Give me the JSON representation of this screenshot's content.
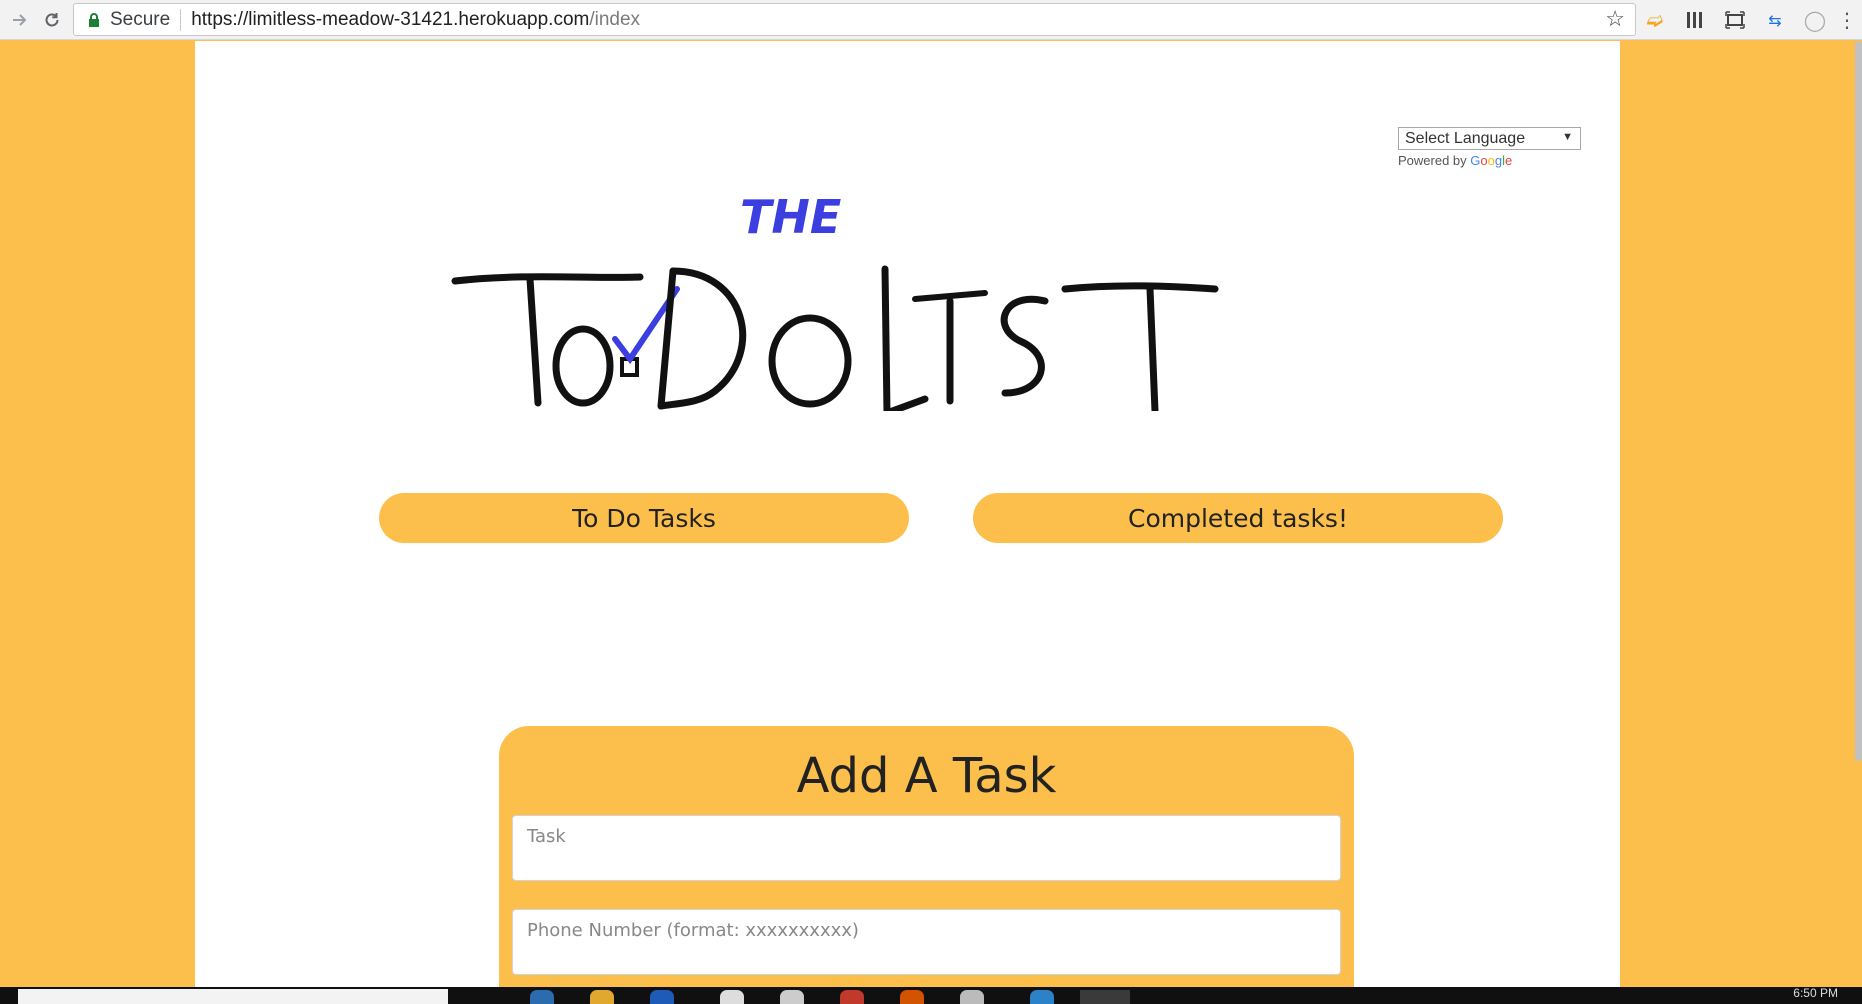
{
  "browser": {
    "secure_label": "Secure",
    "url_base": "https://limitless-meadow-31421.herokuapp.com",
    "url_path": "/index",
    "icons": [
      "forward-icon",
      "reload-icon",
      "lock-icon",
      "bookmark-star-icon",
      "extension-arrow-icon",
      "extension-bars-icon",
      "extension-screen-icon",
      "extension-swap-icon",
      "extension-circle-icon",
      "menu-kebab-icon"
    ]
  },
  "translate": {
    "select_label": "Select Language",
    "powered_by": "Powered by",
    "google": [
      "G",
      "o",
      "o",
      "g",
      "l",
      "e"
    ]
  },
  "logo": {
    "the": "THE",
    "todo_list": "ToDoList",
    "colors": {
      "ink": "#111111",
      "accent": "#3b3fe0"
    }
  },
  "nav": {
    "todo_tasks": "To Do Tasks",
    "completed_tasks": "Completed tasks!"
  },
  "form": {
    "title": "Add A Task",
    "task_placeholder": "Task",
    "phone_placeholder": "Phone Number (format: xxxxxxxxxx)"
  },
  "taskbar": {
    "clock": "6:50 PM"
  },
  "colors": {
    "page_background": "#fdbf4b",
    "content_background": "#ffffff",
    "button_color": "#fdbf4b"
  }
}
